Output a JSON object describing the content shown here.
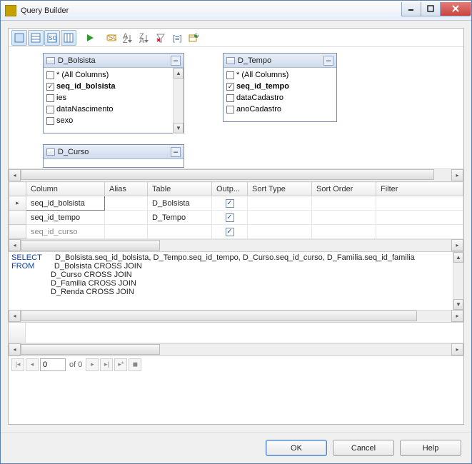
{
  "window": {
    "title": "Query Builder"
  },
  "toolbar_icons": [
    "pane-diagram",
    "pane-grid",
    "pane-sql",
    "pane-results",
    "run",
    "sql",
    "sort-asc",
    "sort-desc",
    "filter",
    "group-by",
    "add-table"
  ],
  "tables": {
    "bolsista": {
      "name": "D_Bolsista",
      "columns": [
        {
          "label": "* (All Columns)",
          "checked": false
        },
        {
          "label": "seq_id_bolsista",
          "checked": true,
          "bold": true
        },
        {
          "label": "ies",
          "checked": false
        },
        {
          "label": "dataNascimento",
          "checked": false
        },
        {
          "label": "sexo",
          "checked": false
        }
      ]
    },
    "tempo": {
      "name": "D_Tempo",
      "columns": [
        {
          "label": "* (All Columns)",
          "checked": false
        },
        {
          "label": "seq_id_tempo",
          "checked": true,
          "bold": true
        },
        {
          "label": "dataCadastro",
          "checked": false
        },
        {
          "label": "anoCadastro",
          "checked": false
        }
      ]
    },
    "curso": {
      "name": "D_Curso"
    }
  },
  "grid": {
    "headers": {
      "column": "Column",
      "alias": "Alias",
      "table": "Table",
      "output": "Outp...",
      "sort_type": "Sort Type",
      "sort_order": "Sort Order",
      "filter": "Filter"
    },
    "rows": [
      {
        "column": "seq_id_bolsista",
        "alias": "",
        "table": "D_Bolsista",
        "output": true
      },
      {
        "column": "seq_id_tempo",
        "alias": "",
        "table": "D_Tempo",
        "output": true
      },
      {
        "column": "seq_id_curso",
        "alias": "",
        "table": "",
        "output": true
      }
    ]
  },
  "sql": {
    "select_kw": "SELECT",
    "select_cols": "D_Bolsista.seq_id_bolsista, D_Tempo.seq_id_tempo, D_Curso.seq_id_curso, D_Familia.seq_id_familia",
    "from_kw": "FROM",
    "from_lines": [
      "D_Bolsista CROSS JOIN",
      "D_Curso CROSS JOIN",
      "D_Familia CROSS JOIN",
      "D_Renda CROSS JOIN"
    ]
  },
  "nav": {
    "pos": "0",
    "of": "of 0"
  },
  "buttons": {
    "ok": "OK",
    "cancel": "Cancel",
    "help": "Help"
  }
}
